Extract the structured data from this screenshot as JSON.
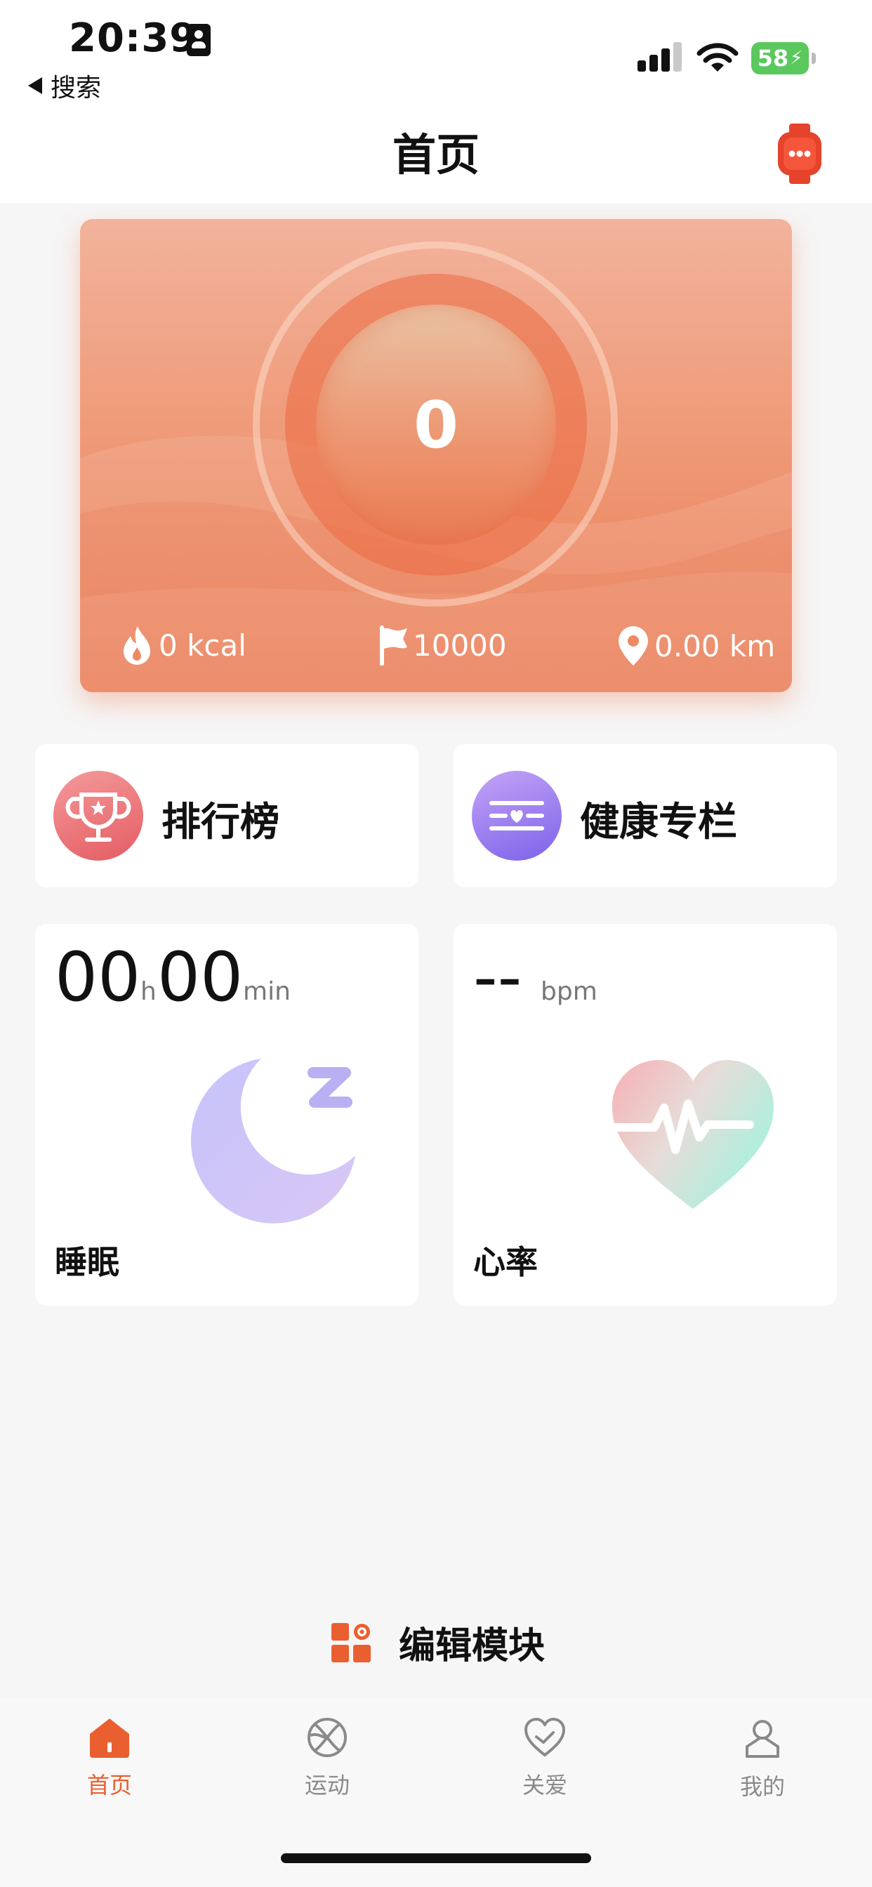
{
  "status_bar": {
    "time": "20:39",
    "back_label": "搜索",
    "battery_level": "58"
  },
  "header": {
    "title": "首页",
    "device_icon": "smartwatch-icon"
  },
  "step_card": {
    "steps": "0",
    "calories": "0 kcal",
    "goal": "10000",
    "distance": "0.00 km",
    "accent": "#ec7d55"
  },
  "shortcuts": [
    {
      "label": "排行榜",
      "icon": "trophy-icon"
    },
    {
      "label": "健康专栏",
      "icon": "health-column-icon"
    }
  ],
  "sleep": {
    "hours": "00",
    "hours_unit": "h",
    "minutes": "00",
    "minutes_unit": "min",
    "label": "睡眠"
  },
  "heart_rate": {
    "value": "--",
    "unit": "bpm",
    "label": "心率"
  },
  "edit_module": {
    "label": "编辑模块"
  },
  "tabs": [
    {
      "label": "首页",
      "icon": "home-icon",
      "active": true
    },
    {
      "label": "运动",
      "icon": "sport-ball-icon",
      "active": false
    },
    {
      "label": "关爱",
      "icon": "care-heart-icon",
      "active": false
    },
    {
      "label": "我的",
      "icon": "profile-icon",
      "active": false
    }
  ],
  "colors": {
    "brand_orange": "#ea5f2f",
    "battery_green": "#5ac85c"
  }
}
